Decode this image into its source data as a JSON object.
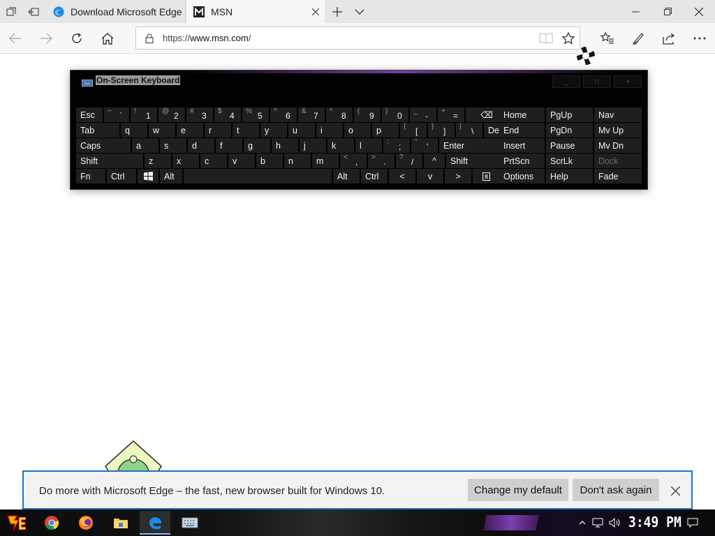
{
  "browser": {
    "tabs": [
      {
        "title": "Download Microsoft Edge",
        "active": false
      },
      {
        "title": "MSN",
        "active": true
      }
    ],
    "url_prefix": "https://",
    "url_domain": "www.msn.com",
    "url_path": "/"
  },
  "osk": {
    "title": "On-Screen Keyboard",
    "controls": [
      "_",
      "□",
      "×"
    ],
    "rows": [
      [
        {
          "label": "Esc"
        },
        {
          "shift": "~",
          "main": "`"
        },
        {
          "shift": "!",
          "main": "1"
        },
        {
          "shift": "@",
          "main": "2"
        },
        {
          "shift": "#",
          "main": "3"
        },
        {
          "shift": "$",
          "main": "4"
        },
        {
          "shift": "%",
          "main": "5"
        },
        {
          "shift": "^",
          "main": "6"
        },
        {
          "shift": "&",
          "main": "7"
        },
        {
          "shift": "*",
          "main": "8"
        },
        {
          "shift": "(",
          "main": "9"
        },
        {
          "shift": ")",
          "main": "0"
        },
        {
          "shift": "_",
          "main": "-"
        },
        {
          "shift": "+",
          "main": "="
        },
        {
          "label": "⌫"
        }
      ],
      [
        {
          "label": "Tab"
        },
        {
          "label": "q"
        },
        {
          "label": "w"
        },
        {
          "label": "e"
        },
        {
          "label": "r"
        },
        {
          "label": "t"
        },
        {
          "label": "y"
        },
        {
          "label": "u"
        },
        {
          "label": "i"
        },
        {
          "label": "o"
        },
        {
          "label": "p"
        },
        {
          "shift": "{",
          "main": "["
        },
        {
          "shift": "}",
          "main": "]"
        },
        {
          "shift": "|",
          "main": "\\"
        },
        {
          "label": "Del"
        }
      ],
      [
        {
          "label": "Caps"
        },
        {
          "label": "a"
        },
        {
          "label": "s"
        },
        {
          "label": "d"
        },
        {
          "label": "f"
        },
        {
          "label": "g"
        },
        {
          "label": "h"
        },
        {
          "label": "j"
        },
        {
          "label": "k"
        },
        {
          "label": "l"
        },
        {
          "shift": ":",
          "main": ";"
        },
        {
          "shift": "\"",
          "main": "'"
        },
        {
          "label": "Enter"
        }
      ],
      [
        {
          "label": "Shift"
        },
        {
          "label": "z"
        },
        {
          "label": "x"
        },
        {
          "label": "c"
        },
        {
          "label": "v"
        },
        {
          "label": "b"
        },
        {
          "label": "n"
        },
        {
          "label": "m"
        },
        {
          "shift": "<",
          "main": ","
        },
        {
          "shift": ">",
          "main": "."
        },
        {
          "shift": "?",
          "main": "/"
        },
        {
          "label": "^"
        },
        {
          "label": "Shift"
        }
      ],
      [
        {
          "label": "Fn"
        },
        {
          "label": "Ctrl"
        },
        {
          "label": "win-logo"
        },
        {
          "label": "Alt"
        },
        {
          "label": ""
        },
        {
          "label": "Alt"
        },
        {
          "label": "Ctrl"
        },
        {
          "label": "<"
        },
        {
          "label": "v"
        },
        {
          "label": ">"
        },
        {
          "label": "menu"
        }
      ]
    ],
    "nav_keys": [
      [
        "Home",
        "PgUp",
        "Nav"
      ],
      [
        "End",
        "PgDn",
        "Mv Up"
      ],
      [
        "Insert",
        "Pause",
        "Mv Dn"
      ],
      [
        "PrtScn",
        "ScrLk",
        "Dock"
      ],
      [
        "Options",
        "Help",
        "Fade"
      ]
    ]
  },
  "notification": {
    "text": "Do more with Microsoft Edge – the fast, new browser built for Windows 10.",
    "change_default": "Change my default",
    "dont_ask": "Don't ask again"
  },
  "taskbar": {
    "apps": [
      "start",
      "chrome",
      "firefox",
      "file-explorer",
      "edge",
      "on-screen-keyboard"
    ],
    "clock": "3:49 PM"
  }
}
